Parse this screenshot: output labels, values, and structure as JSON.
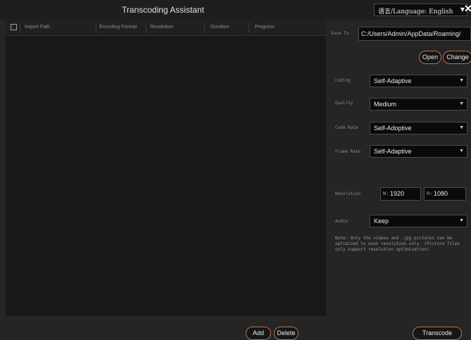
{
  "window": {
    "title": "Transcoding Assistant",
    "language": "语言/Language: English",
    "close": "✕"
  },
  "table": {
    "columns": [
      "Import Path",
      "Encoding Format",
      "Resolution",
      "Duration",
      "Progress"
    ]
  },
  "buttons": {
    "add": "Add",
    "delete": "Delete",
    "open": "Open",
    "change": "Change",
    "transcode": "Transcode"
  },
  "settings": {
    "save_to_label": "Save To",
    "save_to_value": "C:/Users/Admin/AppData/Roaming/",
    "coding_label": "Coding",
    "coding_value": "Self-Adaptive",
    "quality_label": "Quality",
    "quality_value": "Medium",
    "code_rate_label": "Code Rate",
    "code_rate_value": "Self-Adoptive",
    "frame_rate_label": "Frame Rate",
    "frame_rate_value": "Self-Adaptive",
    "resolution_label": "Resolution",
    "width_prefix": "W:",
    "width_value": "1920",
    "height_prefix": "H:",
    "height_value": "1080",
    "audio_label": "Audio",
    "audio_value": "Keep",
    "note": "Note: Only the videos and .jpg pictures can be optimized to even resolution only. (Picture files only support resolution optimization)"
  },
  "colors": {
    "background": "#252525",
    "list_background": "#181818",
    "button_border": "#c07040"
  }
}
